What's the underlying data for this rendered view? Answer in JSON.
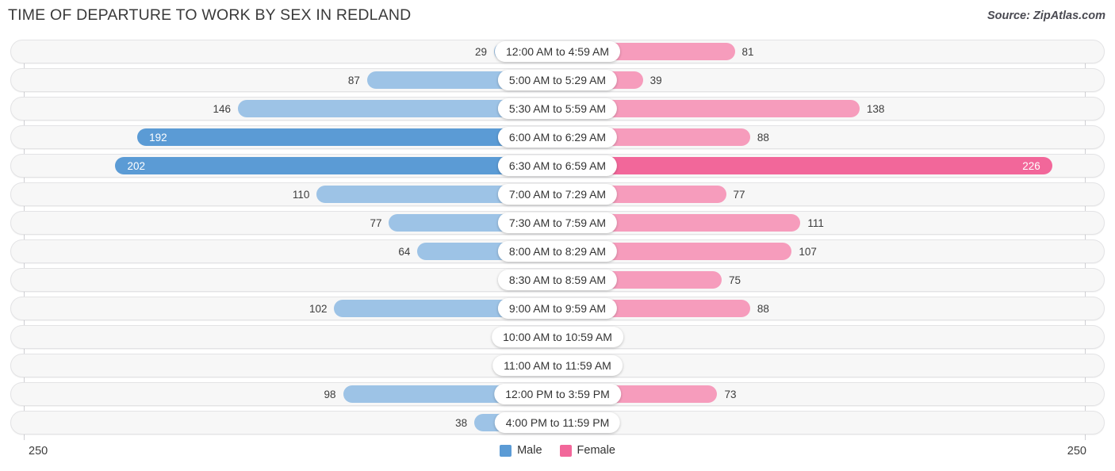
{
  "header": {
    "title": "TIME OF DEPARTURE TO WORK BY SEX IN REDLAND",
    "source": "Source: ZipAtlas.com"
  },
  "legend": {
    "male_label": "Male",
    "female_label": "Female",
    "male_color": "#5B9BD5",
    "female_color": "#F2679A"
  },
  "axis": {
    "left_max_label": "250",
    "right_max_label": "250"
  },
  "colors": {
    "male_light": "#9DC3E6",
    "male_dark": "#5B9BD5",
    "female_light": "#F69CBC",
    "female_dark": "#F2679A",
    "track_fill": "#F7F7F7",
    "track_border": "#E3E3E5"
  },
  "chart_data": {
    "type": "bar",
    "subtype": "diverging-horizontal",
    "title": "TIME OF DEPARTURE TO WORK BY SEX IN REDLAND",
    "xlabel": "",
    "ylabel": "",
    "xlim": [
      250,
      250
    ],
    "grid": false,
    "legend_position": "bottom-center",
    "categories": [
      "12:00 AM to 4:59 AM",
      "5:00 AM to 5:29 AM",
      "5:30 AM to 5:59 AM",
      "6:00 AM to 6:29 AM",
      "6:30 AM to 6:59 AM",
      "7:00 AM to 7:29 AM",
      "7:30 AM to 7:59 AM",
      "8:00 AM to 8:29 AM",
      "8:30 AM to 8:59 AM",
      "9:00 AM to 9:59 AM",
      "10:00 AM to 10:59 AM",
      "11:00 AM to 11:59 AM",
      "12:00 PM to 3:59 PM",
      "4:00 PM to 11:59 PM"
    ],
    "series": [
      {
        "name": "Male",
        "color": "#5B9BD5",
        "values": [
          29,
          87,
          146,
          192,
          202,
          110,
          77,
          64,
          0,
          102,
          0,
          12,
          98,
          38
        ]
      },
      {
        "name": "Female",
        "color": "#F2679A",
        "values": [
          81,
          39,
          138,
          88,
          226,
          77,
          111,
          107,
          75,
          88,
          0,
          12,
          73,
          0
        ]
      }
    ]
  }
}
